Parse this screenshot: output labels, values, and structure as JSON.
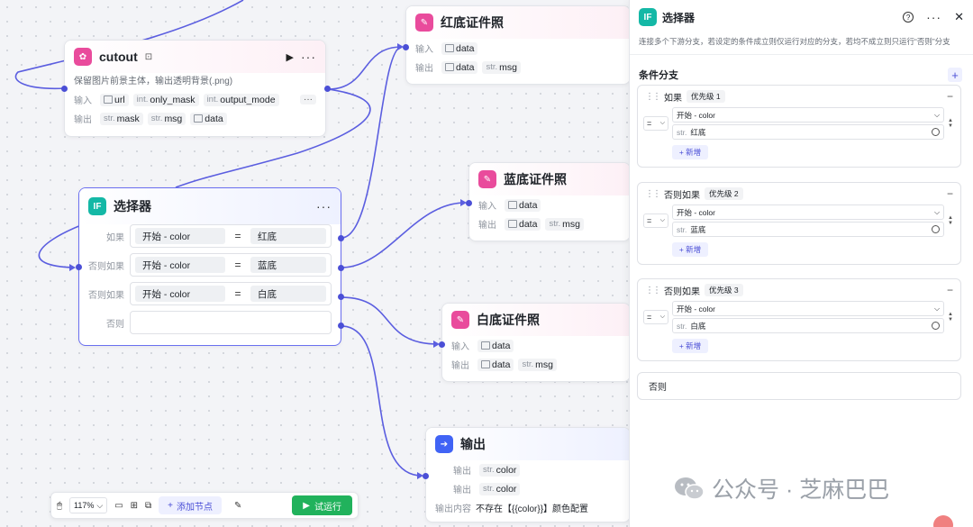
{
  "nodes": {
    "cutout": {
      "title": "cutout",
      "desc": "保留图片前景主体，输出透明背景(.png)",
      "in_label": "输入",
      "out_label": "输出",
      "inputs": [
        {
          "type": "",
          "name": "url",
          "img": true
        },
        {
          "type": "int.",
          "name": "only_mask"
        },
        {
          "type": "int.",
          "name": "output_mode"
        }
      ],
      "outputs": [
        {
          "type": "str.",
          "name": "mask"
        },
        {
          "type": "str.",
          "name": "msg"
        },
        {
          "type": "",
          "name": "data",
          "img": true
        }
      ],
      "more_btn": "···"
    },
    "red": {
      "title": "红底证件照",
      "in_label": "输入",
      "out_label": "输出",
      "in": "data",
      "out1": "data",
      "out2_type": "str.",
      "out2": "msg"
    },
    "blue": {
      "title": "蓝底证件照",
      "in_label": "输入",
      "out_label": "输出",
      "in": "data",
      "out1": "data",
      "out2_type": "str.",
      "out2": "msg"
    },
    "white": {
      "title": "白底证件照",
      "in_label": "输入",
      "out_label": "输出",
      "in": "data",
      "out1": "data",
      "out2_type": "str.",
      "out2": "msg"
    },
    "selector": {
      "title": "选择器",
      "icon": "IF",
      "rows": [
        {
          "label": "如果",
          "left": "开始  -  color",
          "op": "=",
          "right": "红底"
        },
        {
          "label": "否则如果",
          "left": "开始  -  color",
          "op": "=",
          "right": "蓝底"
        },
        {
          "label": "否则如果",
          "left": "开始  -  color",
          "op": "=",
          "right": "白底"
        },
        {
          "label": "否则",
          "left": "",
          "op": "",
          "right": ""
        }
      ]
    },
    "output": {
      "title": "输出",
      "row1_label": "输出",
      "row1_type": "str.",
      "row1": "color",
      "row2_label": "输出",
      "row2_type": "str.",
      "row2": "color",
      "row3_label": "输出内容",
      "row3": "不存在【{{color}}】颜色配置"
    }
  },
  "panel": {
    "icon": "IF",
    "title": "选择器",
    "desc": "连接多个下游分支，若设定的条件成立则仅运行对应的分支，若均不成立则只运行“否则”分支",
    "section": "条件分支",
    "cards": [
      {
        "label": "如果",
        "priority": "优先级 1",
        "op": "=",
        "left": "开始 - color",
        "type": "str.",
        "value": "红底",
        "add": "+ 新增"
      },
      {
        "label": "否则如果",
        "priority": "优先级 2",
        "op": "=",
        "left": "开始 - color",
        "type": "str.",
        "value": "蓝底",
        "add": "+ 新增"
      },
      {
        "label": "否则如果",
        "priority": "优先级 3",
        "op": "=",
        "left": "开始 - color",
        "type": "str.",
        "value": "白底",
        "add": "+ 新增"
      }
    ],
    "else_label": "否则"
  },
  "toolbar": {
    "zoom": "117%",
    "add_node": "添加节点",
    "run": "试运行"
  },
  "watermark": {
    "text": "公众号 · 芝麻巴巴"
  },
  "colors": {
    "accent": "#4b4fd6",
    "wire": "#5b5ee0",
    "run": "#21b25c",
    "pink_icon": "#e94b9c",
    "teal_icon": "#14b8a6"
  }
}
